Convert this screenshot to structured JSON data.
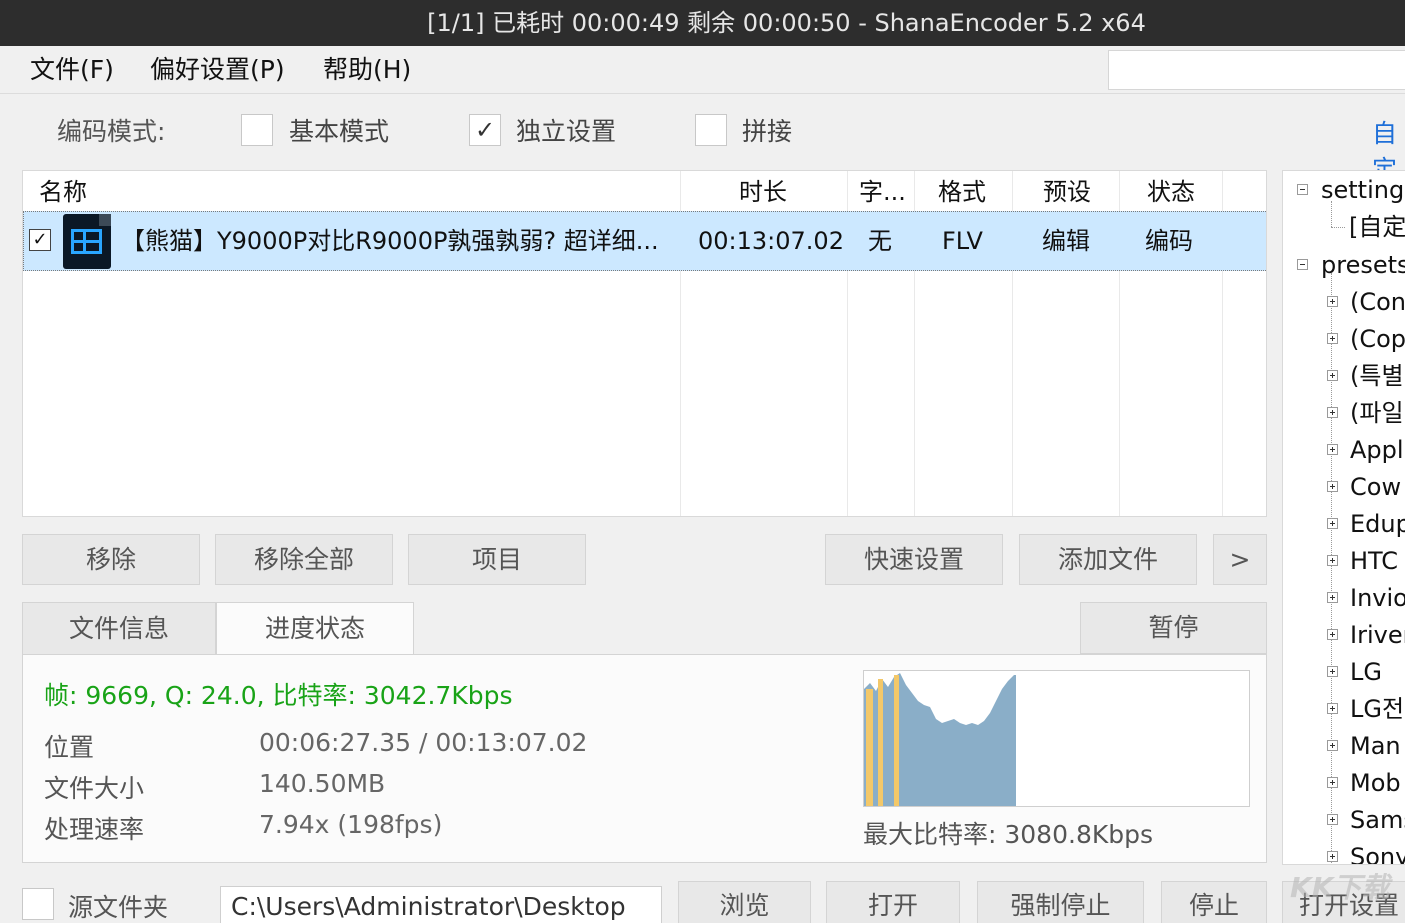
{
  "window": {
    "title": "[1/1] 已耗时 00:00:49   剩余 00:00:50 - ShanaEncoder 5.2 x64"
  },
  "menu": {
    "file": "文件(F)",
    "preferences": "偏好设置(P)",
    "help": "帮助(H)"
  },
  "mode": {
    "label": "编码模式:",
    "basic": "基本模式",
    "basic_checked": false,
    "independent": "独立设置",
    "independent_checked": true,
    "concat": "拼接",
    "concat_checked": false,
    "custom_link": "自定"
  },
  "table": {
    "headers": {
      "name": "名称",
      "duration": "时长",
      "subtitle": "字...",
      "format": "格式",
      "preset": "预设",
      "status": "状态"
    },
    "rows": [
      {
        "checked": true,
        "name": "【熊猫】Y9000P对比R9000P孰强孰弱? 超详细...",
        "duration": "00:13:07.02",
        "subtitle": "无",
        "format": "FLV",
        "preset": "编辑",
        "status": "编码"
      }
    ]
  },
  "list_buttons": {
    "remove": "移除",
    "remove_all": "移除全部",
    "item": "项目",
    "quick_settings": "快速设置",
    "add_file": "添加文件",
    "more": ">"
  },
  "tabs": {
    "file_info": "文件信息",
    "progress": "进度状态",
    "pause": "暂停"
  },
  "progress": {
    "frame_line": "帧: 9669, Q: 24.0, 比特率: 3042.7Kbps",
    "position_label": "位置",
    "position_value": "00:06:27.35 / 00:13:07.02",
    "filesize_label": "文件大小",
    "filesize_value": "140.50MB",
    "speed_label": "处理速率",
    "speed_value": "7.94x (198fps)",
    "max_bitrate": "最大比特率: 3080.8Kbps",
    "colors": {
      "frame_line": "#19a317",
      "graph_area": "#8aaec8",
      "graph_marker": "#f3c869"
    }
  },
  "tree": {
    "root_settings": "settings",
    "custom_child": "[自定",
    "root_presets": "presets",
    "items": [
      "(Con",
      "(Cop",
      "(특별",
      "(파일",
      "Appl",
      "Cow",
      "Edup",
      "HTC",
      "Invio",
      "Iriver",
      "LG",
      "LG전",
      "Man",
      "Mob",
      "Sams",
      "Sony"
    ]
  },
  "bottom": {
    "source_folder_label": "源文件夹",
    "source_folder_checked": false,
    "path": "C:\\Users\\Administrator\\Desktop",
    "browse": "浏览",
    "open": "打开",
    "force_stop": "强制停止",
    "stop": "停止",
    "open_settings": "打开设置"
  },
  "watermark": "KK下载"
}
